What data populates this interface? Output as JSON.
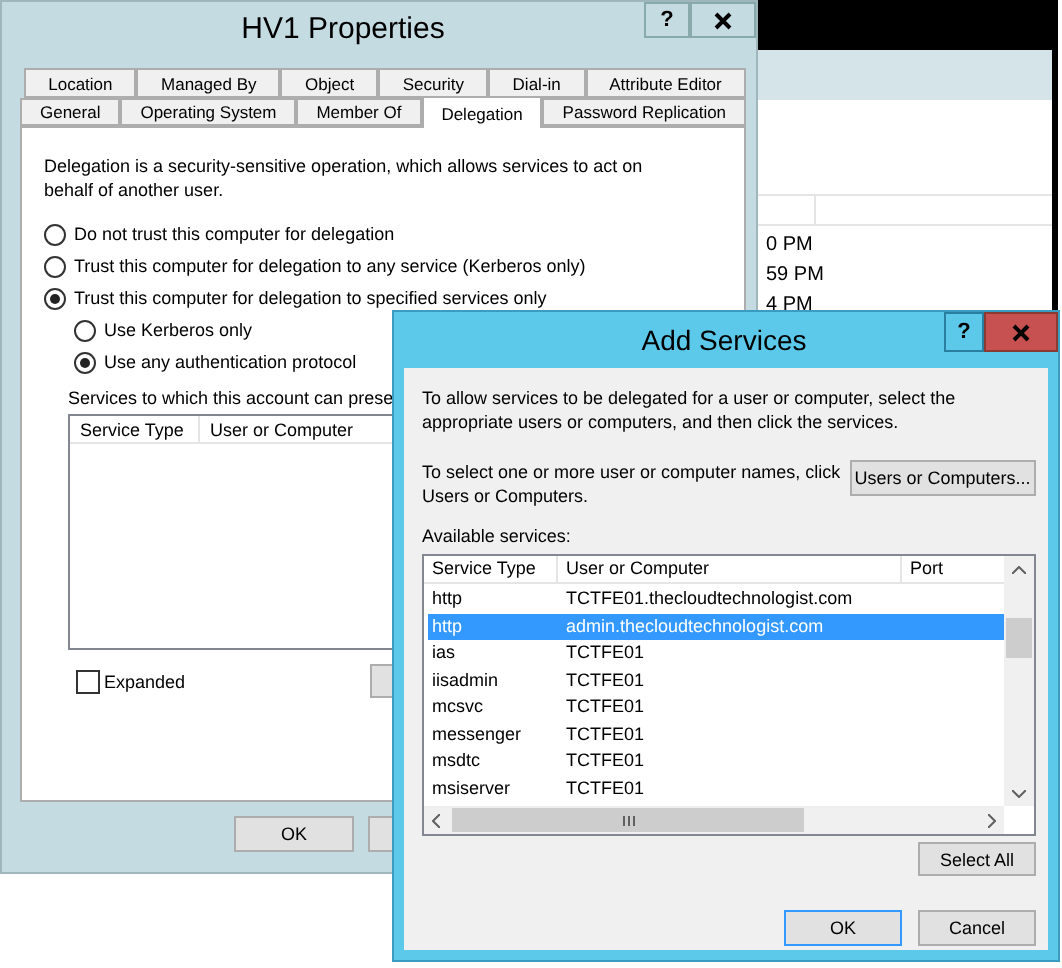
{
  "background_window": {
    "rows": [
      "0 PM",
      "59 PM",
      "4 PM"
    ]
  },
  "hv1_window": {
    "title": "HV1 Properties",
    "help": "?",
    "tabs_row_1": [
      {
        "label": "Location",
        "selected": false
      },
      {
        "label": "Managed By",
        "selected": false
      },
      {
        "label": "Object",
        "selected": false
      },
      {
        "label": "Security",
        "selected": false
      },
      {
        "label": "Dial-in",
        "selected": false
      },
      {
        "label": "Attribute Editor",
        "selected": false
      }
    ],
    "tabs_row_2": [
      {
        "label": "General",
        "selected": false
      },
      {
        "label": "Operating System",
        "selected": false
      },
      {
        "label": "Member Of",
        "selected": false
      },
      {
        "label": "Delegation",
        "selected": true
      },
      {
        "label": "Password Replication",
        "selected": false
      }
    ],
    "description": "Delegation is a security-sensitive operation, which allows services to act on behalf of another user.",
    "options": [
      {
        "label": "Do not trust this computer for delegation",
        "selected": false
      },
      {
        "label": "Trust this computer for delegation to any service (Kerberos only)",
        "selected": false
      },
      {
        "label": "Trust this computer for delegation to specified services only",
        "selected": true,
        "children": [
          {
            "label": "Use Kerberos only",
            "selected": false
          },
          {
            "label": "Use any authentication protocol",
            "selected": true
          }
        ]
      }
    ],
    "services_label": "Services to which this account can prese",
    "services_columns": [
      "Service Type",
      "User or Computer"
    ],
    "expanded": {
      "label": "Expanded",
      "checked": false
    },
    "buttons": [
      "OK"
    ]
  },
  "add_services": {
    "title": "Add Services",
    "help": "?",
    "intro": "To allow services to be delegated for a user or computer, select the appropriate users or computers, and then click the services.",
    "select_hint": "To select one or more user or computer names, click Users or Computers.",
    "users_button": "Users or Computers...",
    "available_label": "Available services:",
    "columns": [
      "Service Type",
      "User or Computer",
      "Port"
    ],
    "rows": [
      {
        "service_type": "http",
        "user_or_computer": "TCTFE01.thecloudtechnologist.com",
        "selected": false
      },
      {
        "service_type": "http",
        "user_or_computer": "admin.thecloudtechnologist.com",
        "selected": true
      },
      {
        "service_type": "ias",
        "user_or_computer": "TCTFE01",
        "selected": false
      },
      {
        "service_type": "iisadmin",
        "user_or_computer": "TCTFE01",
        "selected": false
      },
      {
        "service_type": "mcsvc",
        "user_or_computer": "TCTFE01",
        "selected": false
      },
      {
        "service_type": "messenger",
        "user_or_computer": "TCTFE01",
        "selected": false
      },
      {
        "service_type": "msdtc",
        "user_or_computer": "TCTFE01",
        "selected": false
      },
      {
        "service_type": "msiserver",
        "user_or_computer": "TCTFE01",
        "selected": false
      }
    ],
    "select_all": "Select All",
    "buttons": [
      "OK",
      "Cancel"
    ]
  }
}
